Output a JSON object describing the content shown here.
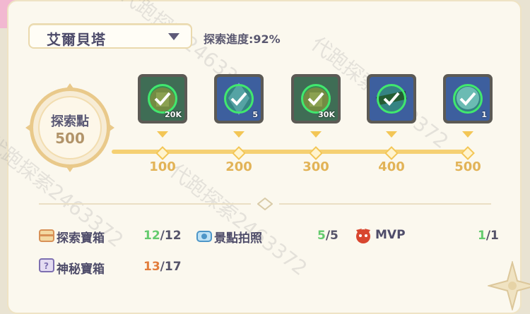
{
  "header": {
    "location": "艾爾貝塔",
    "progress_label": "探索進度:92%"
  },
  "points_medal": {
    "label": "探索點",
    "value": "500"
  },
  "milestones": [
    {
      "points": "100",
      "qty": "20K",
      "icon": "coin-bag-icon",
      "claimed": true
    },
    {
      "points": "200",
      "qty": "5",
      "icon": "blue-crystal-icon",
      "claimed": true
    },
    {
      "points": "300",
      "qty": "30K",
      "icon": "coin-bag-icon",
      "claimed": true
    },
    {
      "points": "400",
      "qty": "",
      "icon": "blade-item-icon",
      "claimed": true
    },
    {
      "points": "500",
      "qty": "1",
      "icon": "blue-orb-icon",
      "claimed": true
    }
  ],
  "stats": {
    "treasure": {
      "label": "探索寶箱",
      "done": "12",
      "total": "/12"
    },
    "photo": {
      "label": "景點拍照",
      "done": "5",
      "total": "/5"
    },
    "mvp": {
      "label": "MVP",
      "done": "1",
      "total": "/1"
    },
    "mystery": {
      "label": "神秘寶箱",
      "done": "13",
      "total": "/17"
    }
  },
  "watermark": "代跑探索2463372",
  "colors": {
    "accent_gold": "#f3c656",
    "check_green": "#41e86e",
    "done_green": "#64cb6e",
    "done_orange": "#e27d3c"
  }
}
